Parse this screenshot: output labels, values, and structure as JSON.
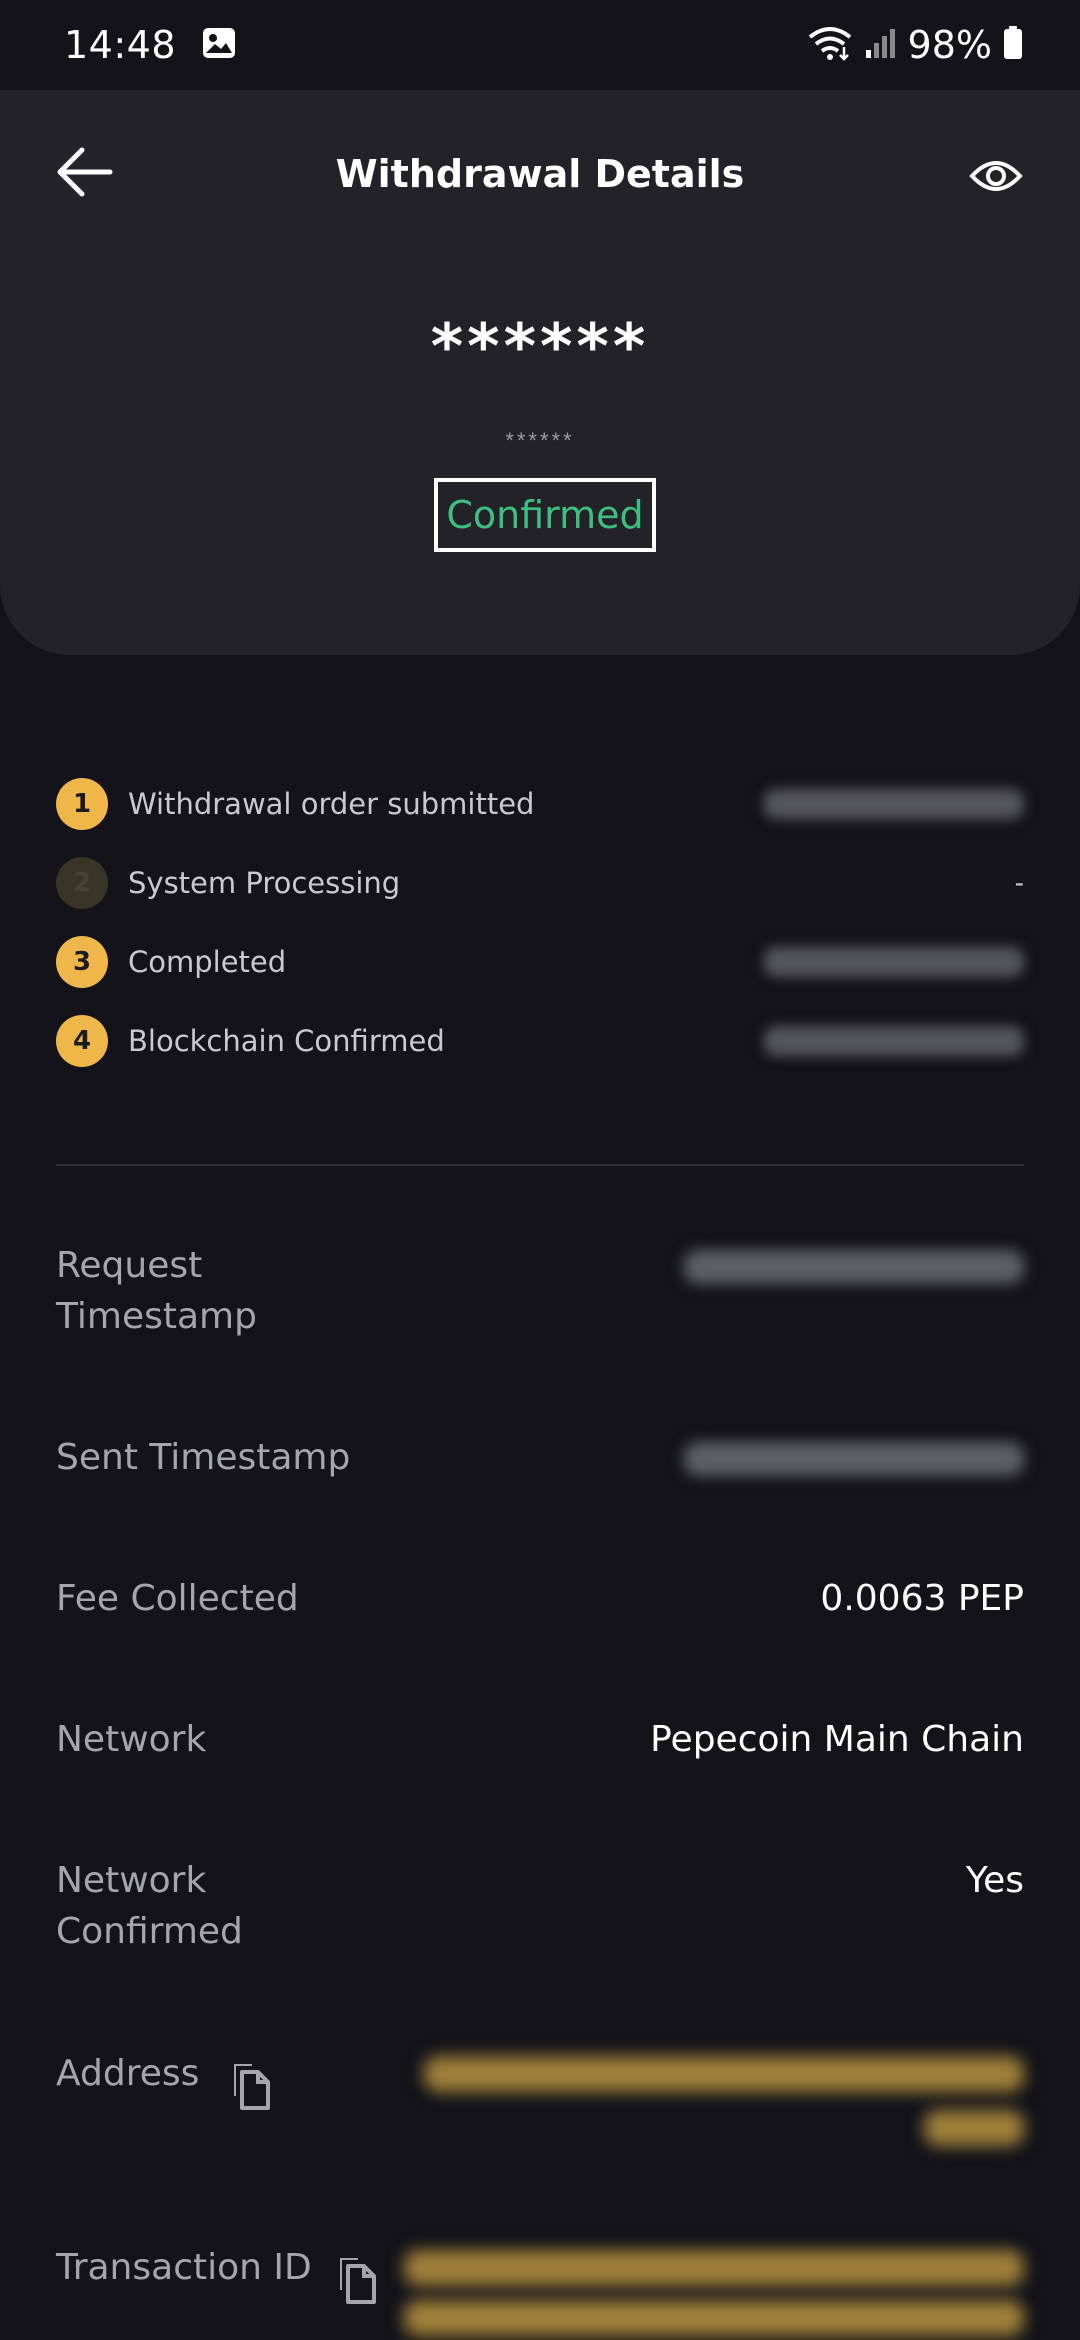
{
  "status_bar": {
    "time": "14:48",
    "battery": "98%",
    "icons": [
      "gallery-icon",
      "wifi-icon",
      "signal-icon",
      "battery-icon"
    ]
  },
  "header": {
    "title": "Withdrawal Details",
    "amount_masked": "******",
    "amount_sub_masked": "******",
    "status": "Confirmed",
    "status_color": "#3fbf7f"
  },
  "steps": [
    {
      "num": "1",
      "label": "Withdrawal order submitted",
      "time": "",
      "active": true
    },
    {
      "num": "2",
      "label": "System Processing",
      "time": "-",
      "active": false
    },
    {
      "num": "3",
      "label": "Completed",
      "time": "",
      "active": true
    },
    {
      "num": "4",
      "label": "Blockchain Confirmed",
      "time": "",
      "active": true
    }
  ],
  "details": {
    "request_timestamp_label": "Request Timestamp",
    "sent_timestamp_label": "Sent Timestamp",
    "fee_label": "Fee Collected",
    "fee_value": "0.0063 PEP",
    "network_label": "Network",
    "network_value": "Pepecoin Main Chain",
    "network_confirmed_label": "Network Confirmed",
    "network_confirmed_value": "Yes",
    "address_label": "Address",
    "txid_label": "Transaction ID"
  },
  "colors": {
    "accent": "#efb74a",
    "background": "#131319",
    "card": "#222228"
  }
}
